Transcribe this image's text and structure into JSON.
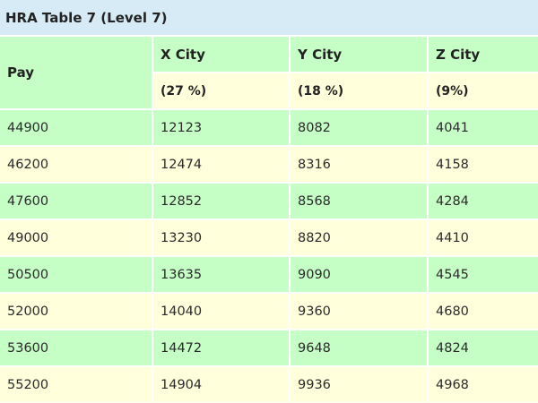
{
  "table": {
    "caption": "HRA Table 7 (Level 7)",
    "headers": {
      "pay": "Pay",
      "x_city": "X City",
      "y_city": "Y City",
      "z_city": "Z City",
      "x_rate": "(27 %)",
      "y_rate": "(18 %)",
      "z_rate": "(9%)"
    },
    "rows": [
      [
        "44900",
        "12123",
        "8082",
        "4041"
      ],
      [
        "46200",
        "12474",
        "8316",
        "4158"
      ],
      [
        "47600",
        "12852",
        "8568",
        "4284"
      ],
      [
        "49000",
        "13230",
        "8820",
        "4410"
      ],
      [
        "50500",
        "13635",
        "9090",
        "4545"
      ],
      [
        "52000",
        "14040",
        "9360",
        "4680"
      ],
      [
        "53600",
        "14472",
        "9648",
        "4824"
      ],
      [
        "55200",
        "14904",
        "9936",
        "4968"
      ]
    ]
  },
  "colors": {
    "caption_bg": "#d6ebf6",
    "green_row": "#c6ffc6",
    "yellow_row": "#ffffdc"
  }
}
